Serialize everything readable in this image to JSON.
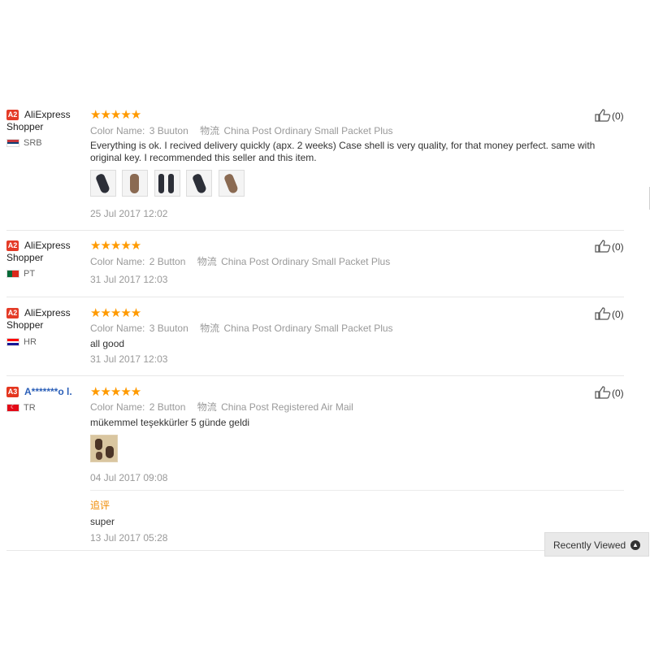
{
  "labels": {
    "color_name": "Color Name:",
    "shipping": "物流",
    "followup": "追评",
    "recently_viewed": "Recently Viewed"
  },
  "colors": {
    "star": "#ff9a00",
    "badge": "#e43b27",
    "followup": "#f08a00"
  },
  "reviews": [
    {
      "badge": "A2",
      "user": "AliExpress Shopper",
      "country": "SRB",
      "flag": [
        "#c6363c",
        "#0c4076",
        "#ffffff"
      ],
      "stars": "★★★★★",
      "color_value": "3 Buuton",
      "shipping_value": "China Post Ordinary Small Packet Plus",
      "text": "Everything is ok. I recived delivery quickly (apx. 2 weeks) Case shell is very quality, for that money perfect. same with original key. I recommended this seller and this item.",
      "photos": 5,
      "date": "25 Jul 2017 12:02",
      "likes": "(0)"
    },
    {
      "badge": "A2",
      "user": "AliExpress Shopper",
      "country": "PT",
      "flag": [
        "#046a38",
        "#da291c"
      ],
      "stars": "★★★★★",
      "color_value": "2 Button",
      "shipping_value": "China Post Ordinary Small Packet Plus",
      "date": "31 Jul 2017 12:03",
      "likes": "(0)"
    },
    {
      "badge": "A2",
      "user": "AliExpress Shopper",
      "country": "HR",
      "flag": [
        "#ff0000",
        "#ffffff",
        "#171796"
      ],
      "stars": "★★★★★",
      "color_value": "3 Buuton",
      "shipping_value": "China Post Ordinary Small Packet Plus",
      "text": "all good",
      "date": "31 Jul 2017 12:03",
      "likes": "(0)"
    },
    {
      "badge": "A3",
      "user": "A*******o l.",
      "country": "TR",
      "flag": [
        "#e30a17"
      ],
      "stars": "★★★★★",
      "color_value": "2 Button",
      "shipping_value": "China Post Registered Air Mail",
      "text": "mükemmel teşekkürler 5 günde geldi",
      "photos": 1,
      "date": "04 Jul 2017 09:08",
      "followup_text": "super",
      "followup_date": "13 Jul 2017 05:28",
      "likes": "(0)"
    }
  ]
}
